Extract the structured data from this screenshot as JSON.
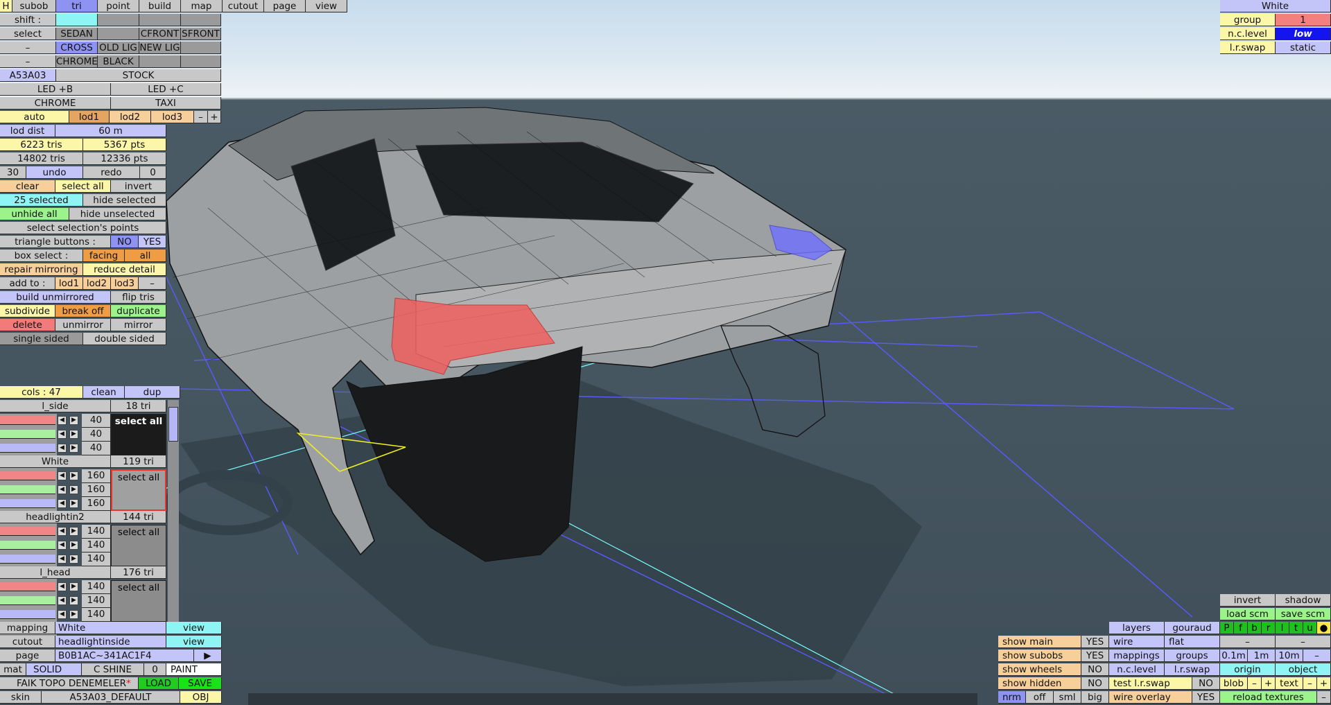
{
  "tabs": [
    "H",
    "subob",
    "tri",
    "point",
    "build",
    "map",
    "cutout",
    "page",
    "view"
  ],
  "shift_label": "shift :",
  "select_row": {
    "label": "select",
    "opts": [
      "SEDAN",
      "",
      "CFRONT",
      "SFRONT"
    ]
  },
  "cross_row": {
    "label": "–",
    "opts": [
      "CROSS",
      "OLD LIG",
      "NEW LIG",
      ""
    ]
  },
  "chrome_row": {
    "label": "–",
    "opts": [
      "CHROME",
      "BLACK",
      "",
      ""
    ]
  },
  "car_row": {
    "id": "A53A03",
    "variant": "STOCK"
  },
  "led": [
    "LED +B",
    "LED +C"
  ],
  "chrome_taxi": [
    "CHROME",
    "TAXI"
  ],
  "lod_row": {
    "auto": "auto",
    "lods": [
      "lod1",
      "lod2",
      "lod3"
    ],
    "minus": "–",
    "plus": "+"
  },
  "lod_dist": {
    "label": "lod dist",
    "value": "60 m"
  },
  "stats": {
    "tris1": "6223 tris",
    "pts1": "5367 pts",
    "tris2": "14802 tris",
    "pts2": "12336 pts"
  },
  "undo_row": {
    "count": "30",
    "undo": "undo",
    "redo": "redo",
    "redo_count": "0"
  },
  "sel_row": {
    "clear": "clear",
    "select_all": "select all",
    "invert": "invert"
  },
  "selected_row": {
    "count": "25 selected",
    "hide": "hide selected"
  },
  "unhide_row": {
    "unhide": "unhide all",
    "hide_un": "hide unselected"
  },
  "select_points": "select selection's points",
  "tri_buttons": {
    "label": "triangle buttons :",
    "no": "NO",
    "yes": "YES"
  },
  "box_select": {
    "label": "box select :",
    "facing": "facing",
    "all": "all"
  },
  "repair_row": {
    "repair": "repair mirroring",
    "reduce": "reduce detail"
  },
  "add_to": {
    "label": "add to :",
    "lods": [
      "lod1",
      "lod2",
      "lod3"
    ],
    "minus": "–"
  },
  "build_row": {
    "build": "build unmirrored",
    "flip": "flip tris"
  },
  "subdivide_row": {
    "subdivide": "subdivide",
    "break": "break off",
    "duplicate": "duplicate"
  },
  "delete_row": {
    "delete": "delete",
    "unmirror": "unmirror",
    "mirror": "mirror"
  },
  "sided_row": {
    "single": "single sided",
    "double": "double sided"
  },
  "cols_row": {
    "label": "cols : 47",
    "clean": "clean",
    "dup": "dup"
  },
  "materials": [
    {
      "name": "l_side",
      "tris": "18 tri",
      "vals": [
        "40",
        "40",
        "40"
      ],
      "btn": "select all",
      "color": "#1b1b1b"
    },
    {
      "name": "White",
      "tris": "119 tri",
      "vals": [
        "160",
        "160",
        "160"
      ],
      "btn": "select all",
      "color": "#a0a0a0"
    },
    {
      "name": "headlightin2",
      "tris": "144 tri",
      "vals": [
        "140",
        "140",
        "140"
      ],
      "btn": "select all",
      "color": "#8c8c8c"
    },
    {
      "name": "l_head",
      "tris": "176 tri",
      "vals": [
        "140",
        "140",
        "140"
      ],
      "btn": "select all",
      "color": "#8c8c8c"
    }
  ],
  "bottom_left": {
    "mapping": {
      "label": "mapping",
      "value": "White",
      "btn": "view"
    },
    "cutout": {
      "label": "cutout",
      "value": "headlightinside",
      "btn": "view"
    },
    "page": {
      "label": "page",
      "value": "B0B1AC~341AC1F4",
      "btn": "▶"
    },
    "mat": {
      "label": "mat",
      "solid": "SOLID",
      "cshine": "C SHINE",
      "num": "0",
      "paint": "PAINT"
    },
    "file": {
      "name": "FAIK TOPO DENEMELER",
      "star": "*",
      "load": "LOAD",
      "save": "SAVE"
    },
    "skin": {
      "label": "skin",
      "value": "A53A03_DEFAULT",
      "obj": "OBJ"
    }
  },
  "top_right": {
    "title": "White",
    "group_label": "group",
    "group_val": "1",
    "nclevel_label": "n.c.level",
    "nclevel_val": "low",
    "lrswap_label": "l.r.swap",
    "lrswap_val": "static"
  },
  "bottom_right": {
    "show_main": "show main",
    "show_main_v": "YES",
    "show_subobs": "show subobs",
    "show_subobs_v": "YES",
    "show_wheels": "show wheels",
    "show_wheels_v": "NO",
    "show_hidden": "show hidden",
    "show_hidden_v": "NO",
    "nrm": [
      "nrm",
      "off",
      "sml",
      "big"
    ],
    "layers": "layers",
    "gouraud": "gouraud",
    "wire": "wire",
    "flat": "flat",
    "mappings": "mappings",
    "groups": "groups",
    "nclevel": "n.c.level",
    "lrswap": "l.r.swap",
    "test_lr": "test l.r.swap",
    "test_lr_v": "NO",
    "wire_overlay": "wire overlay",
    "wire_overlay_v": "YES",
    "invert": "invert",
    "shadow": "shadow",
    "load_scm": "load scm",
    "save_scm": "save scm",
    "letters": [
      "P",
      "f",
      "b",
      "r",
      "l",
      "t",
      "u",
      "●"
    ],
    "dash1": "–",
    "dash2": "–",
    "scales": [
      "0.1m",
      "1m",
      "10m",
      "–"
    ],
    "origin": "origin",
    "object": "object",
    "blob": "blob",
    "text": "text",
    "reload": "reload textures",
    "minus": "–",
    "plus": "+"
  },
  "colors": {
    "selection": "#f06060",
    "wire_grid": "#5a5aff",
    "cyan_line": "#7ff",
    "yellow_outline": "#ee2"
  }
}
